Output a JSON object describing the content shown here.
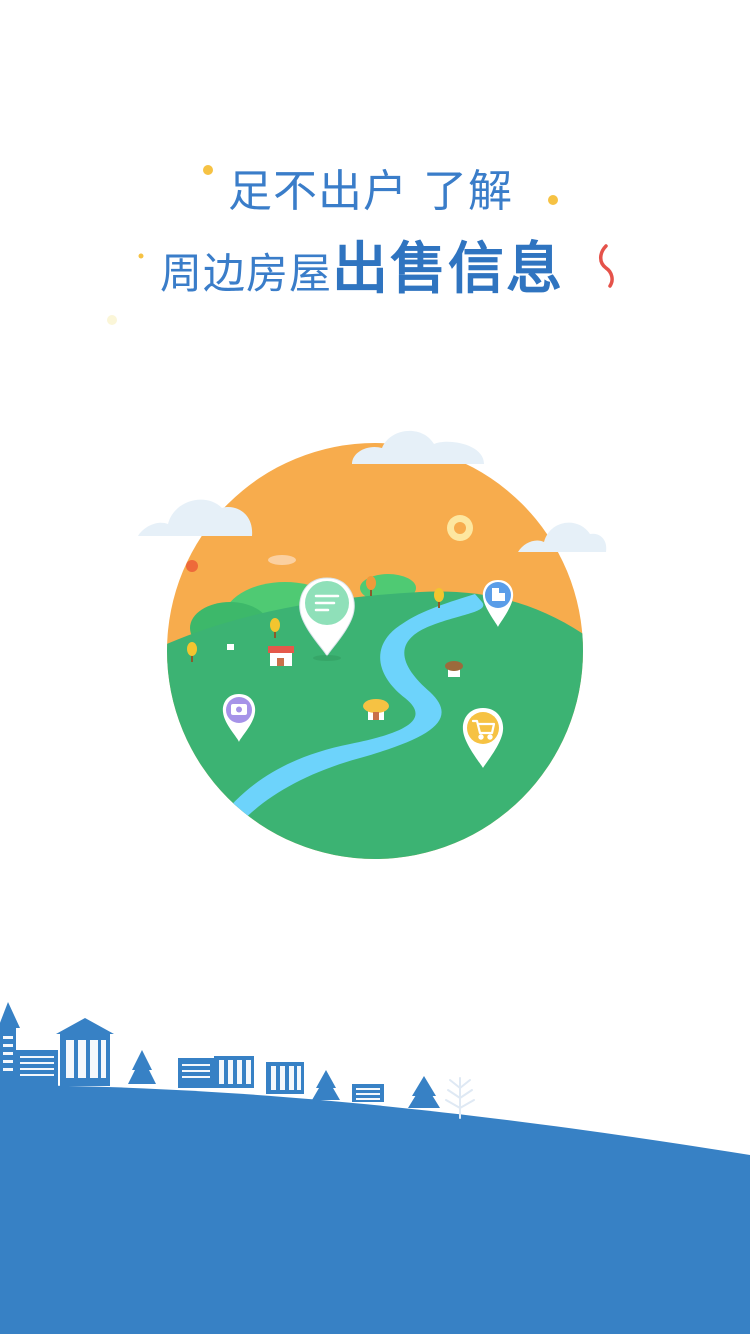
{
  "headline": {
    "line1": "足不出户 了解",
    "line2_light": "周边房屋",
    "line2_bold": "出售信息"
  },
  "colors": {
    "primary_blue": "#3a7dc9",
    "ground_blue": "#3781c5",
    "sky_orange": "#f7ac4d",
    "grass_green": "#3cb373",
    "river_blue": "#6dd3fb",
    "accent_yellow": "#f6c243"
  },
  "icons": {
    "main_pin": "document-list-icon",
    "building_pin": "building-icon",
    "camera_pin": "camera-icon",
    "cart_pin": "shopping-cart-icon"
  }
}
